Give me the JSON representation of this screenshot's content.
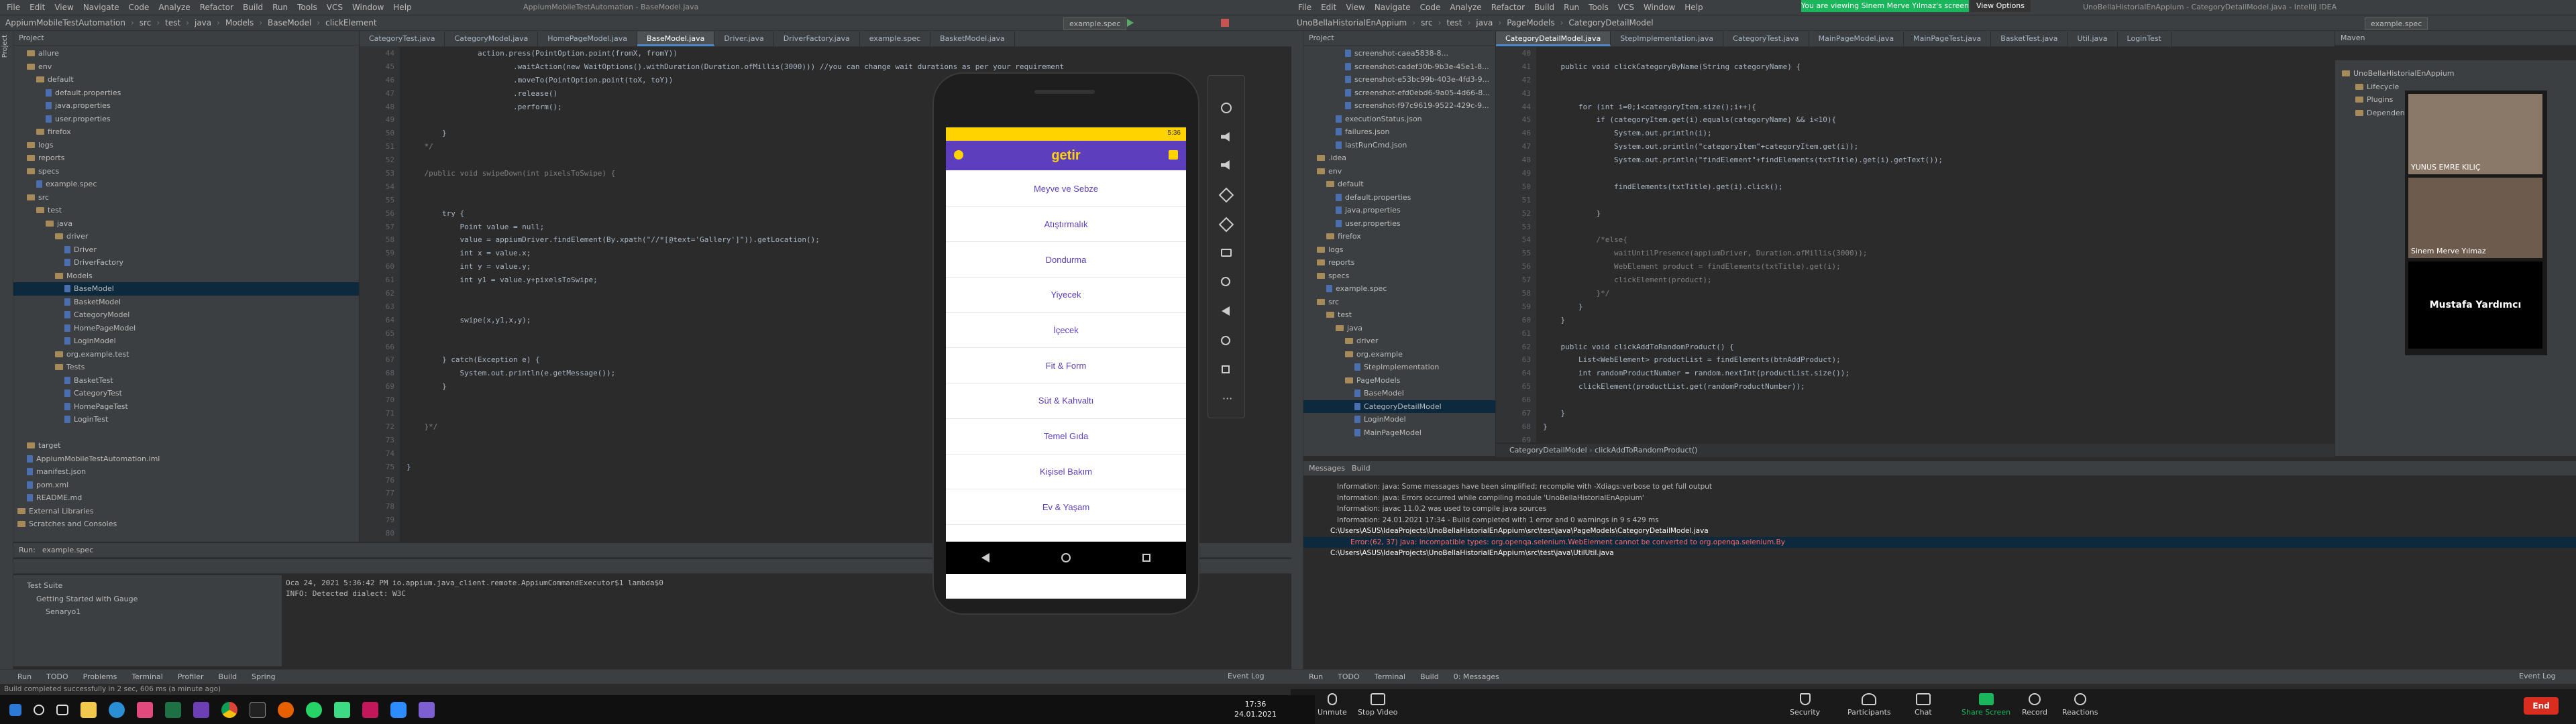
{
  "left_ide": {
    "menu": [
      "File",
      "Edit",
      "View",
      "Navigate",
      "Code",
      "Analyze",
      "Refactor",
      "Build",
      "Run",
      "Tools",
      "VCS",
      "Window",
      "Help"
    ],
    "title": "AppiumMobileTestAutomation - BaseModel.java",
    "breadcrumb": [
      "AppiumMobileTestAutomation",
      "src",
      "test",
      "java",
      "Models",
      "BaseModel",
      "clickElement"
    ],
    "run_config": "example.spec",
    "tabs": [
      "CategoryTest.java",
      "CategoryModel.java",
      "HomePageModel.java",
      "BaseModel.java",
      "Driver.java",
      "DriverFactory.java",
      "example.spec",
      "BasketModel.java"
    ],
    "active_tab": 3,
    "project_label": "Project",
    "tree": [
      {
        "label": "allure",
        "depth": 1,
        "type": "folder"
      },
      {
        "label": "env",
        "depth": 1,
        "type": "folder"
      },
      {
        "label": "default",
        "depth": 2,
        "type": "folder"
      },
      {
        "label": "default.properties",
        "depth": 3,
        "type": "file"
      },
      {
        "label": "java.properties",
        "depth": 3,
        "type": "file"
      },
      {
        "label": "user.properties",
        "depth": 3,
        "type": "file"
      },
      {
        "label": "firefox",
        "depth": 2,
        "type": "folder"
      },
      {
        "label": "logs",
        "depth": 1,
        "type": "folder"
      },
      {
        "label": "reports",
        "depth": 1,
        "type": "folder"
      },
      {
        "label": "specs",
        "depth": 1,
        "type": "folder"
      },
      {
        "label": "example.spec",
        "depth": 2,
        "type": "file"
      },
      {
        "label": "src",
        "depth": 1,
        "type": "folder"
      },
      {
        "label": "test",
        "depth": 2,
        "type": "folder"
      },
      {
        "label": "java",
        "depth": 3,
        "type": "folder"
      },
      {
        "label": "driver",
        "depth": 4,
        "type": "folder"
      },
      {
        "label": "Driver",
        "depth": 5,
        "type": "file"
      },
      {
        "label": "DriverFactory",
        "depth": 5,
        "type": "file"
      },
      {
        "label": "Models",
        "depth": 4,
        "type": "folder"
      },
      {
        "label": "BaseModel",
        "depth": 5,
        "type": "file",
        "selected": true
      },
      {
        "label": "BasketModel",
        "depth": 5,
        "type": "file"
      },
      {
        "label": "CategoryModel",
        "depth": 5,
        "type": "file"
      },
      {
        "label": "HomePageModel",
        "depth": 5,
        "type": "file"
      },
      {
        "label": "LoginModel",
        "depth": 5,
        "type": "file"
      },
      {
        "label": "org.example.test",
        "depth": 4,
        "type": "folder"
      },
      {
        "label": "Tests",
        "depth": 4,
        "type": "folder"
      },
      {
        "label": "BasketTest",
        "depth": 5,
        "type": "file"
      },
      {
        "label": "CategoryTest",
        "depth": 5,
        "type": "file"
      },
      {
        "label": "HomePageTest",
        "depth": 5,
        "type": "file"
      },
      {
        "label": "LoginTest",
        "depth": 5,
        "type": "file"
      },
      {
        "label": "",
        "depth": 0,
        "type": "blank"
      },
      {
        "label": "target",
        "depth": 1,
        "type": "folder"
      },
      {
        "label": "AppiumMobileTestAutomation.iml",
        "depth": 1,
        "type": "file"
      },
      {
        "label": "manifest.json",
        "depth": 1,
        "type": "file"
      },
      {
        "label": "pom.xml",
        "depth": 1,
        "type": "file"
      },
      {
        "label": "README.md",
        "depth": 1,
        "type": "file"
      },
      {
        "label": "External Libraries",
        "depth": 0,
        "type": "folder"
      },
      {
        "label": "Scratches and Consoles",
        "depth": 0,
        "type": "folder"
      }
    ],
    "line_numbers": [
      "44",
      "45",
      "46",
      "47",
      "48",
      "49",
      "50",
      "51",
      "52",
      "53",
      "54",
      "55",
      "56",
      "57",
      "58",
      "59",
      "60",
      "61",
      "62",
      "63",
      "64",
      "65",
      "66",
      "67",
      "68",
      "69",
      "70",
      "71",
      "72",
      "73",
      "74",
      "75",
      "76",
      "77",
      "78",
      "79",
      "80",
      "81",
      "82",
      "83",
      "84",
      "85",
      "86",
      "87",
      "88"
    ],
    "code": [
      [
        [
          "",
          "                action.press(PointOption.point(fromX, fromY))"
        ]
      ],
      [
        [
          "",
          "                        .waitAction(new WaitOptions().withDuration(Duration.ofMillis(3000))) //you can change wait durations as per your requirement"
        ]
      ],
      [
        [
          "",
          "                        .moveTo(PointOption.point(toX, toY))"
        ]
      ],
      [
        [
          "",
          "                        .release()"
        ]
      ],
      [
        [
          "",
          "                        .perform();"
        ]
      ],
      [
        [
          "",
          ""
        ]
      ],
      [
        [
          "",
          "        }"
        ]
      ],
      [
        [
          "cm",
          "    */"
        ]
      ],
      [
        [
          "",
          ""
        ]
      ],
      [
        [
          "cm",
          "    /public void swipeDown(int pixelsToSwipe) {"
        ]
      ],
      [
        [
          "",
          ""
        ]
      ],
      [
        [
          "",
          ""
        ]
      ],
      [
        [
          "",
          "        try {"
        ]
      ],
      [
        [
          "",
          "            Point value = null;"
        ]
      ],
      [
        [
          "",
          "            value = appiumDriver.findElement(By.xpath(\"//*[@text='Gallery']\")).getLocation();"
        ]
      ],
      [
        [
          "",
          "            int x = value.x;"
        ]
      ],
      [
        [
          "",
          "            int y = value.y;"
        ]
      ],
      [
        [
          "",
          "            int y1 = value.y+pixelsToSwipe;"
        ]
      ],
      [
        [
          "",
          ""
        ]
      ],
      [
        [
          "",
          ""
        ]
      ],
      [
        [
          "",
          "            swipe(x,y1,x,y);"
        ]
      ],
      [
        [
          "",
          ""
        ]
      ],
      [
        [
          "",
          ""
        ]
      ],
      [
        [
          "",
          "        } catch(Exception e) {"
        ]
      ],
      [
        [
          "",
          "            System.out.println(e.getMessage());"
        ]
      ],
      [
        [
          "",
          "        }"
        ]
      ],
      [
        [
          "",
          ""
        ]
      ],
      [
        [
          "",
          ""
        ]
      ],
      [
        [
          "cm",
          "    }*/"
        ]
      ],
      [
        [
          "",
          ""
        ]
      ],
      [
        [
          "",
          ""
        ]
      ],
      [
        [
          "",
          "}"
        ]
      ]
    ],
    "run_panel": {
      "tabs": [
        "Run:",
        "example.spec"
      ],
      "tree": [
        "Test Suite",
        "Getting Started with Gauge",
        "Senaryo1"
      ],
      "log": [
        "Oca 24, 2021 5:36:42 PM io.appium.java_client.remote.AppiumCommandExecutor$1 lambda$0",
        "INFO: Detected dialect: W3C"
      ]
    },
    "bottom_tabs": [
      "Run",
      "TODO",
      "Problems",
      "Terminal",
      "Profiler",
      "Build",
      "Spring"
    ],
    "event_log": "Event Log",
    "status": "Build completed successfully in 2 sec, 606 ms (a minute ago)"
  },
  "phone": {
    "status_time": "5:36",
    "brand": "getir",
    "categories": [
      "Meyve ve Sebze",
      "Atıştırmalık",
      "Dondurma",
      "Yiyecek",
      "İçecek",
      "Fit & Form",
      "Süt & Kahvaltı",
      "Temel Gıda",
      "Kişisel Bakım",
      "Ev & Yaşam"
    ],
    "colors": {
      "header": "#5d3ebc",
      "status": "#ffd300",
      "text": "#5d3ebc"
    }
  },
  "right_ide": {
    "menu": [
      "File",
      "Edit",
      "View",
      "Navigate",
      "Code",
      "Analyze",
      "Refactor",
      "Build",
      "Run",
      "Tools",
      "VCS",
      "Window",
      "Help"
    ],
    "title": "UnoBellaHistorialEnAppium - CategoryDetailModel.java - IntelliJ IDEA",
    "breadcrumb": [
      "UnoBellaHistorialEnAppium",
      "src",
      "test",
      "java",
      "PageModels",
      "CategoryDetailModel"
    ],
    "run_config": "example.spec",
    "tabs": [
      "CategoryDetailModel.java",
      "StepImplementation.java",
      "CategoryTest.java",
      "MainPageModel.java",
      "MainPageTest.java",
      "BasketTest.java",
      "Util.java",
      "LoginTest"
    ],
    "active_tab": 0,
    "banner": "You are viewing Sinem Merve Yılmaz's screen",
    "view_options": "View Options",
    "tree": [
      {
        "label": "screenshot-caea5838-8...",
        "depth": 4,
        "type": "file"
      },
      {
        "label": "screenshot-cadef30b-9b3e-45e1-8...",
        "depth": 4,
        "type": "file"
      },
      {
        "label": "screenshot-e53bc99b-403e-4fd3-9...",
        "depth": 4,
        "type": "file"
      },
      {
        "label": "screenshot-efd0ebd6-9a05-4d66-8...",
        "depth": 4,
        "type": "file"
      },
      {
        "label": "screenshot-f97c9619-9522-429c-9...",
        "depth": 4,
        "type": "file"
      },
      {
        "label": "executionStatus.json",
        "depth": 3,
        "type": "file"
      },
      {
        "label": "failures.json",
        "depth": 3,
        "type": "file"
      },
      {
        "label": "lastRunCmd.json",
        "depth": 3,
        "type": "file"
      },
      {
        "label": ".idea",
        "depth": 1,
        "type": "folder"
      },
      {
        "label": "env",
        "depth": 1,
        "type": "folder"
      },
      {
        "label": "default",
        "depth": 2,
        "type": "folder"
      },
      {
        "label": "default.properties",
        "depth": 3,
        "type": "file"
      },
      {
        "label": "java.properties",
        "depth": 3,
        "type": "file"
      },
      {
        "label": "user.properties",
        "depth": 3,
        "type": "file"
      },
      {
        "label": "firefox",
        "depth": 2,
        "type": "folder"
      },
      {
        "label": "logs",
        "depth": 1,
        "type": "folder"
      },
      {
        "label": "reports",
        "depth": 1,
        "type": "folder"
      },
      {
        "label": "specs",
        "depth": 1,
        "type": "folder"
      },
      {
        "label": "example.spec",
        "depth": 2,
        "type": "file"
      },
      {
        "label": "src",
        "depth": 1,
        "type": "folder"
      },
      {
        "label": "test",
        "depth": 2,
        "type": "folder"
      },
      {
        "label": "java",
        "depth": 3,
        "type": "folder"
      },
      {
        "label": "driver",
        "depth": 4,
        "type": "folder"
      },
      {
        "label": "org.example",
        "depth": 4,
        "type": "folder"
      },
      {
        "label": "StepImplementation",
        "depth": 5,
        "type": "file"
      },
      {
        "label": "PageModels",
        "depth": 4,
        "type": "folder"
      },
      {
        "label": "BaseModel",
        "depth": 5,
        "type": "file"
      },
      {
        "label": "CategoryDetailModel",
        "depth": 5,
        "type": "file",
        "selected": true
      },
      {
        "label": "LoginModel",
        "depth": 5,
        "type": "file"
      },
      {
        "label": "MainPageModel",
        "depth": 5,
        "type": "file"
      }
    ],
    "line_numbers": [
      "40",
      "41",
      "42",
      "43",
      "44",
      "45",
      "46",
      "47",
      "48",
      "49",
      "50",
      "51",
      "52",
      "53",
      "54",
      "55",
      "56",
      "57",
      "58",
      "59",
      "60",
      "61",
      "62",
      "63",
      "64",
      "65",
      "66",
      "67",
      "68",
      "69",
      "70",
      "71",
      "72",
      "73",
      "74",
      "75",
      "76",
      "77",
      "78",
      "79"
    ],
    "code": [
      [
        [
          "",
          ""
        ]
      ],
      [
        [
          "",
          "    public void clickCategoryByName(String categoryName) {"
        ]
      ],
      [
        [
          "",
          ""
        ]
      ],
      [
        [
          "",
          ""
        ]
      ],
      [
        [
          "",
          "        for (int i=0;i<categoryItem.size();i++){"
        ]
      ],
      [
        [
          "",
          "            if (categoryItem.get(i).equals(categoryName) && i<10){"
        ]
      ],
      [
        [
          "",
          "                System.out.println(i);"
        ]
      ],
      [
        [
          "",
          "                System.out.println(\"categoryItem\"+categoryItem.get(i));"
        ]
      ],
      [
        [
          "",
          "                System.out.println(\"findElement\"+findElements(txtTitle).get(i).getText());"
        ]
      ],
      [
        [
          "",
          ""
        ]
      ],
      [
        [
          "",
          "                findElements(txtTitle).get(i).click();"
        ]
      ],
      [
        [
          "",
          ""
        ]
      ],
      [
        [
          "",
          "            }"
        ]
      ],
      [
        [
          "",
          ""
        ]
      ],
      [
        [
          "cm",
          "            /*else{"
        ]
      ],
      [
        [
          "cm",
          "                waitUntilPresence(appiumDriver, Duration.ofMillis(3000));"
        ]
      ],
      [
        [
          "cm",
          "                WebElement product = findElements(txtTitle).get(i);"
        ]
      ],
      [
        [
          "cm",
          "                clickElement(product);"
        ]
      ],
      [
        [
          "cm",
          "            }*/"
        ]
      ],
      [
        [
          "",
          "        }"
        ]
      ],
      [
        [
          "",
          "    }"
        ]
      ],
      [
        [
          "",
          ""
        ]
      ],
      [
        [
          "",
          "    public void clickAddToRandomProduct() {"
        ]
      ],
      [
        [
          "",
          "        List<WebElement> productList = findElements(btnAddProduct);"
        ]
      ],
      [
        [
          "",
          "        int randomProductNumber = random.nextInt(productList.size());"
        ]
      ],
      [
        [
          "",
          "        clickElement(productList.get(randomProductNumber));"
        ]
      ],
      [
        [
          "",
          ""
        ]
      ],
      [
        [
          "",
          "    }"
        ]
      ],
      [
        [
          "",
          "}"
        ]
      ]
    ],
    "editor_crumb": [
      "CategoryDetailModel",
      "clickAddToRandomProduct()"
    ],
    "messages_tabs": [
      "Messages",
      "Build"
    ],
    "messages": [
      "Information: java: Some messages have been simplified; recompile with -Xdiags:verbose to get full output",
      "Information: java: Errors occurred while compiling module 'UnoBellaHistorialEnAppium'",
      "Information: javac 11.0.2 was used to compile java sources",
      "Information: 24.01.2021 17:34 - Build completed with 1 error and 0 warnings in 9 s 429 ms",
      "C:\\Users\\ASUS\\IdeaProjects\\UnoBellaHistorialEnAppium\\src\\test\\java\\PageModels\\CategoryDetailModel.java",
      "Error:(62, 37) java: incompatible types: org.openqa.selenium.WebElement cannot be converted to org.openqa.selenium.By",
      "C:\\Users\\ASUS\\IdeaProjects\\UnoBellaHistorialEnAppium\\src\\test\\java\\UtilUtil.java"
    ],
    "bottom_tabs": [
      "Run",
      "TODO",
      "Terminal",
      "Build",
      "0: Messages"
    ],
    "event_log": "Event Log",
    "maven_label": "Maven",
    "maven_items": [
      "UnoBellaHistorialEnAppium",
      "Lifecycle",
      "Plugins",
      "Dependencies"
    ]
  },
  "zoom": {
    "participants": [
      {
        "name": "YUNUS EMRE KILIÇ"
      },
      {
        "name": "Sinem Merve Yılmaz"
      },
      {
        "name": "Mustafa Yardımcı"
      }
    ],
    "controls": [
      "Unmute",
      "Stop Video",
      "Security",
      "Participants",
      "Chat",
      "Share Screen",
      "Record",
      "Reactions"
    ],
    "end_label": "End",
    "share_color": "#1bb55c",
    "end_color": "#d92d20"
  },
  "taskbar": {
    "time": "17:36",
    "date": "24.01.2021"
  }
}
